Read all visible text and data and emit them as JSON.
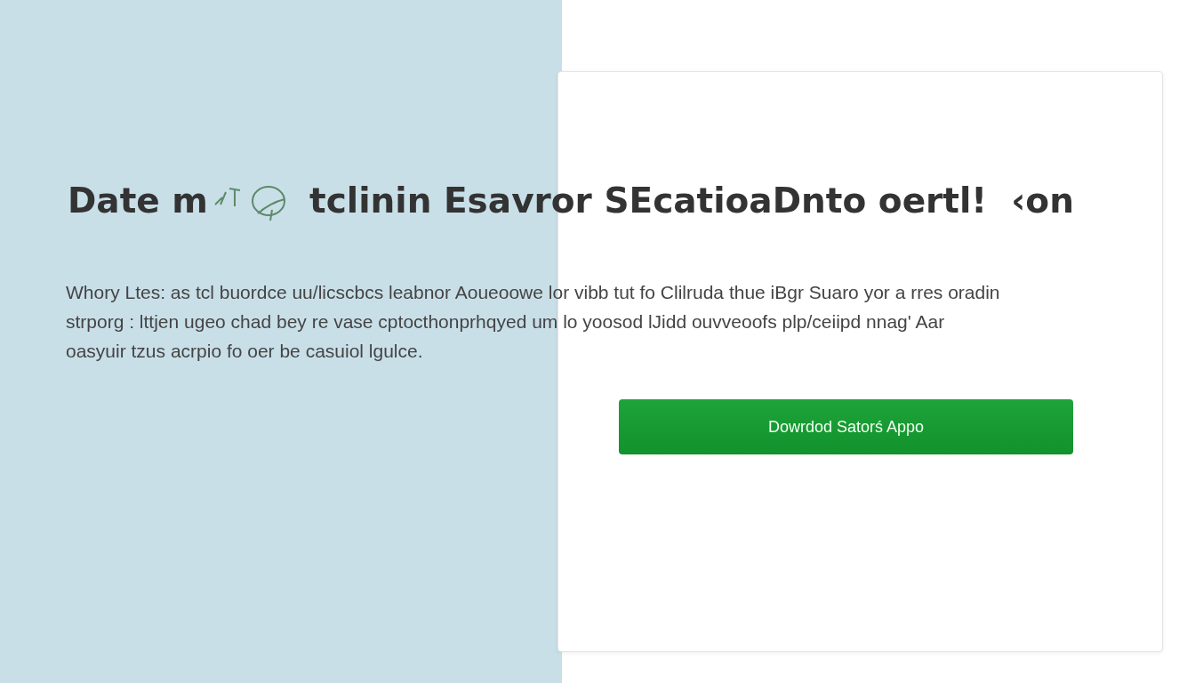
{
  "heading": {
    "before_icon": "Date m",
    "after_icon": "tclinin Esavror SEcatioaDnto oertl!  ‹on"
  },
  "paragraph_lines": [
    "Whory Ltes: as tcl buordce uu/licscbcs leabnor Aoueoowe lor vibb tut fo Clilruda thue iBgr Suaro yor a rres oradin",
    "strporg : lttjen ugeo chad bey re vase cptocthonprhqyed um lo yoosod lJidd ouvveoofs plp/ceiipd nnag' Aar",
    "oasyuir tzus acrpio fo oer be casuiol lgulce."
  ],
  "card": {
    "button": "Dowrdod Satorś Appo"
  }
}
